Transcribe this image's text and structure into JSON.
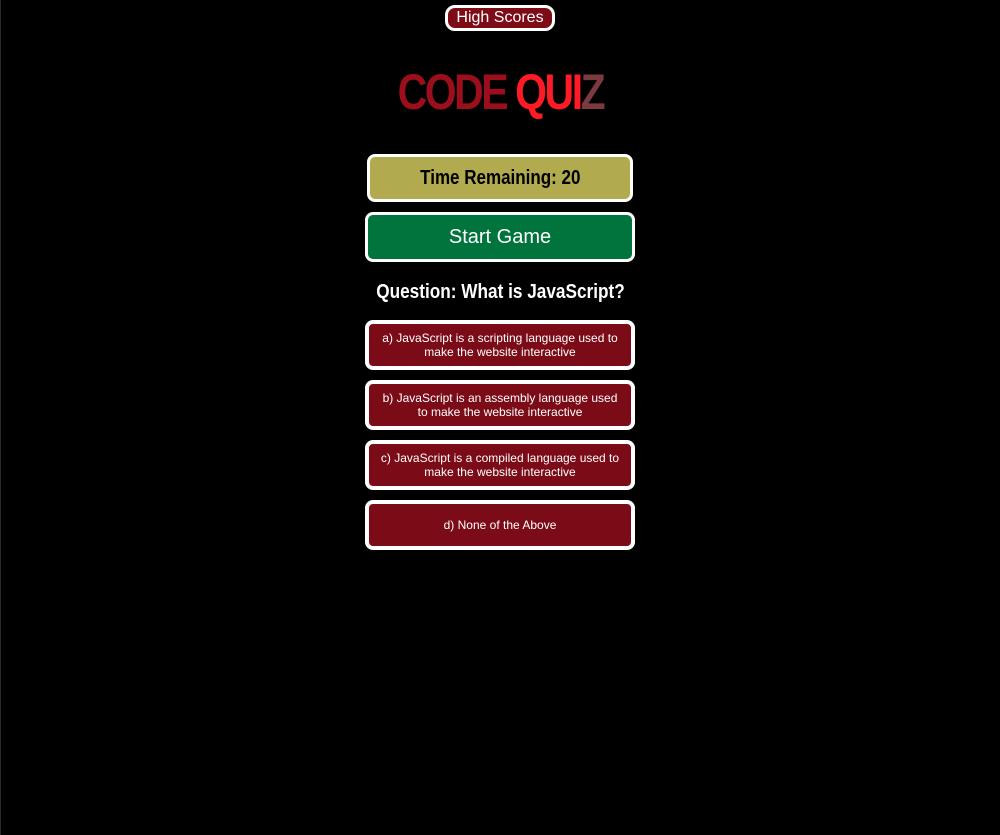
{
  "header": {
    "high_scores_label": "High Scores"
  },
  "title": {
    "part1": "CODE ",
    "part2": "QUI",
    "part3": "Z"
  },
  "timer": {
    "label": "Time Remaining: 20"
  },
  "controls": {
    "start_label": "Start Game"
  },
  "quiz": {
    "question": "Question: What is JavaScript?",
    "answers": [
      "a) JavaScript is a scripting language used to make the website interactive",
      "b) JavaScript is an assembly language used to make the website interactive",
      "c) JavaScript is a compiled language used to make the website interactive",
      "d) None of the Above"
    ]
  },
  "colors": {
    "background": "#000000",
    "answer_bg": "#7b0b17",
    "start_bg": "#00743c",
    "timer_bg": "#b2aa4e",
    "title_dark_red": "#9c0e1c",
    "title_bright_red": "#ff1a26",
    "title_muted": "#7a3a40"
  }
}
